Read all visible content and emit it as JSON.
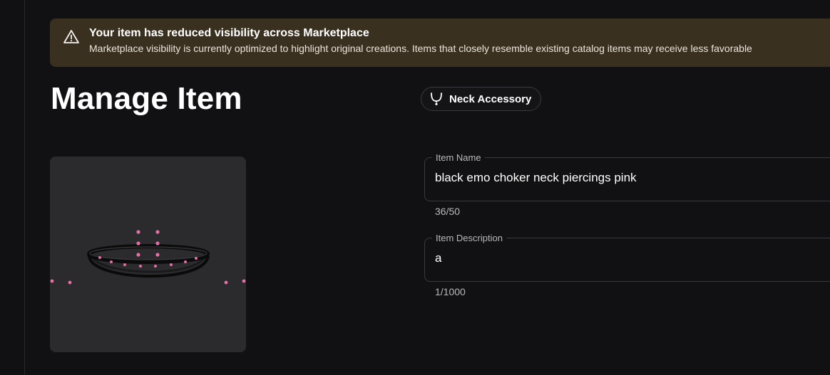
{
  "banner": {
    "icon": "warning-triangle-icon",
    "title": "Your item has reduced visibility across Marketplace",
    "body": "Marketplace visibility is currently optimized to highlight original creations. Items that closely resemble existing catalog items may receive less favorable"
  },
  "page": {
    "title": "Manage Item"
  },
  "category": {
    "icon": "necklace-icon",
    "label": "Neck Accessory"
  },
  "form": {
    "item_name": {
      "label": "Item Name",
      "value": "black emo choker neck piercings pink",
      "counter": "36/50"
    },
    "item_description": {
      "label": "Item Description",
      "value": "a",
      "counter": "1/1000"
    }
  },
  "colors": {
    "background": "#111113",
    "banner_bg": "#3a3020",
    "thumbnail_bg": "#2b2b2d",
    "bead_pink": "#e56fa6"
  }
}
